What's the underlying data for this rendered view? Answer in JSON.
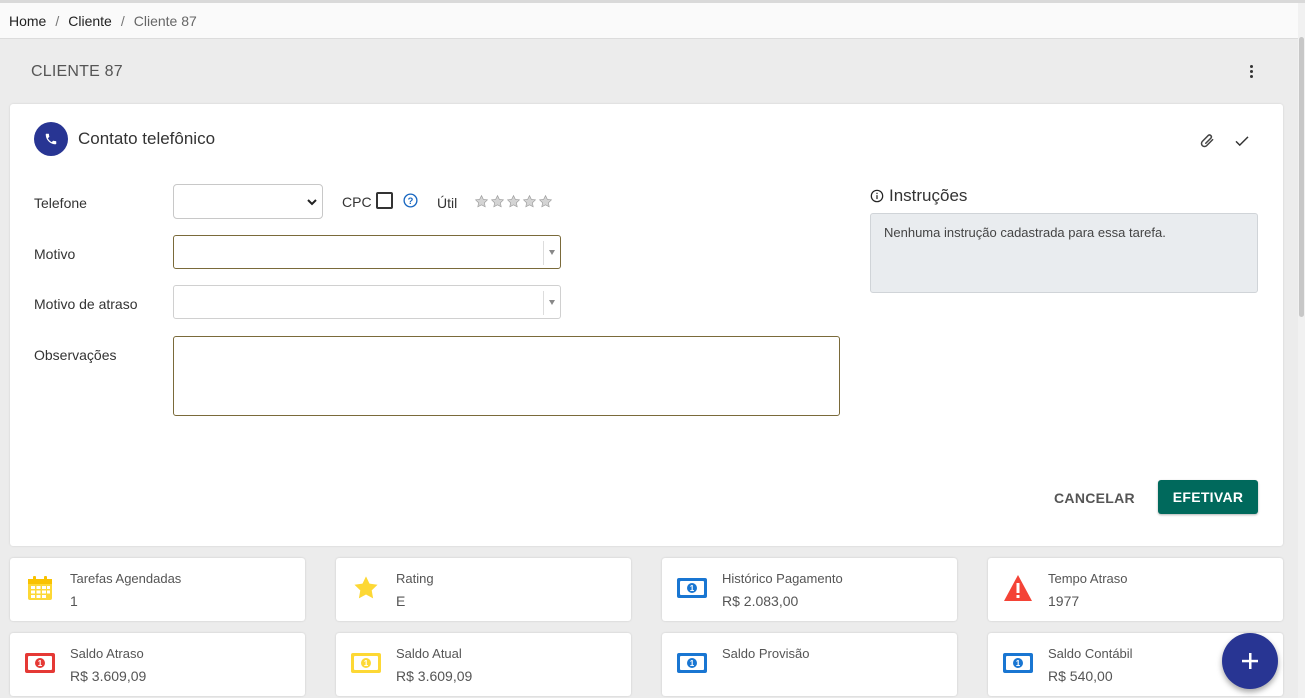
{
  "breadcrumb": {
    "home": "Home",
    "cliente": "Cliente",
    "current": "Cliente 87"
  },
  "page": {
    "title": "CLIENTE 87"
  },
  "card": {
    "title": "Contato telefônico",
    "telefone_label": "Telefone",
    "cpc_label": "CPC",
    "util_label": "Útil",
    "motivo_label": "Motivo",
    "motivo_atraso_label": "Motivo de atraso",
    "observacoes_label": "Observações",
    "instrucoes_title": "Instruções",
    "instrucoes_text": "Nenhuma instrução cadastrada para essa tarefa.",
    "cancel_label": "CANCELAR",
    "submit_label": "EFETIVAR"
  },
  "kpis": [
    {
      "label": "Tarefas Agendadas",
      "value": "1",
      "icon": "calendar-icon"
    },
    {
      "label": "Rating",
      "value": "E",
      "icon": "star-icon"
    },
    {
      "label": "Histórico Pagamento",
      "value": "R$ 2.083,00",
      "icon": "money-icon"
    },
    {
      "label": "Tempo Atraso",
      "value": "1977",
      "icon": "warning-icon"
    },
    {
      "label": "Saldo Atraso",
      "value": "R$ 3.609,09",
      "icon": "money-icon"
    },
    {
      "label": "Saldo Atual",
      "value": "R$ 3.609,09",
      "icon": "money-icon"
    },
    {
      "label": "Saldo Provisão",
      "value": "",
      "icon": "money-icon"
    },
    {
      "label": "Saldo Contábil",
      "value": "R$ 540,00",
      "icon": "money-icon"
    }
  ],
  "colors": {
    "primary": "#283593",
    "accent": "#00695c",
    "money_blue": "#1976d2",
    "money_red": "#e53935",
    "money_yellow": "#fdd835",
    "warning": "#f44336"
  }
}
